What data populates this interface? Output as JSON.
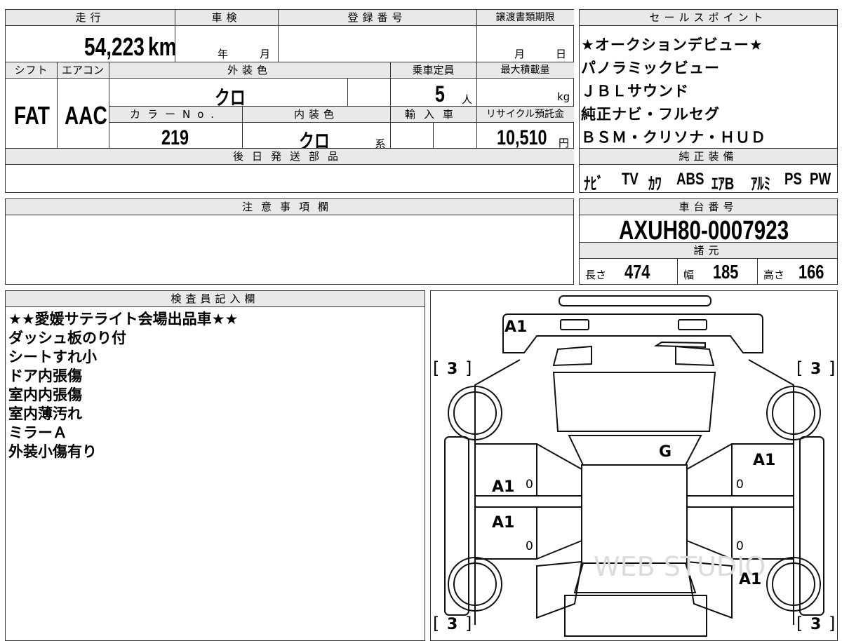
{
  "top_panel": {
    "labels": {
      "mileage": "走行",
      "shaken": "車検",
      "registration": "登録番号",
      "transfer_deadline": "譲渡書類期限",
      "shift": "シフト",
      "aircon": "エアコン",
      "exterior_color": "外装色",
      "capacity": "乗車定員",
      "max_load": "最大積載量",
      "color_no": "カラーNo.",
      "interior_color": "内装色",
      "import": "輸入車",
      "recycle_fee": "リサイクル預託金",
      "delivery_parts": "後日発送部品"
    },
    "mileage_value": "54,223",
    "mileage_unit": "km",
    "year_unit": "年",
    "month_unit": "月",
    "transfer_month_unit": "月",
    "transfer_day_unit": "日",
    "shift_value": "FAT",
    "aircon_value": "AAC",
    "exterior_color_value": "クロ",
    "capacity_value": "5",
    "capacity_unit": "人",
    "max_load_unit": "kg",
    "color_no_value": "219",
    "interior_color_value": "クロ",
    "interior_suffix": "系",
    "recycle_fee_value": "10,510",
    "recycle_fee_unit": "円"
  },
  "sales_points": {
    "header": "セールスポイント",
    "items": [
      "★オークションデビュー★",
      "パノラミックビュー",
      "ＪＢＬサウンド",
      "純正ナビ・フルセグ",
      "ＢＳＭ・クリソナ・ＨＵＤ"
    ]
  },
  "factory_equipment": {
    "header": "純正装備",
    "items": [
      "ﾅﾋﾞ",
      "TV",
      "ｶﾜ",
      "ABS",
      "ｴｱB",
      "ｱﾙﾐ",
      "PS",
      "PW"
    ]
  },
  "notes": {
    "header": "注意事項欄"
  },
  "chassis": {
    "header": "車台番号",
    "value": "AXUH80-0007923"
  },
  "specs": {
    "header": "諸元",
    "length_label": "長さ",
    "length_value": "474",
    "width_label": "幅",
    "width_value": "185",
    "height_label": "高さ",
    "height_value": "166"
  },
  "inspector": {
    "header": "検査員記入欄",
    "lines": [
      "★★愛媛サテライト会場出品車★★",
      "ダッシュ板のり付",
      "シートすれ小",
      "ドア内張傷",
      "室内内張傷",
      "室内薄汚れ",
      "ミラーＡ",
      "外装小傷有り"
    ]
  },
  "diagram": {
    "tire_grade": "3",
    "front_mark": "A1",
    "windshield_mark": "G",
    "left_front_door_mark": "A1",
    "left_rear_door_mark": "A1",
    "right_front_door_mark": "A1",
    "right_rear_mark": "A1",
    "zero_mark": "0",
    "watermark": "WEB STUDIO"
  }
}
